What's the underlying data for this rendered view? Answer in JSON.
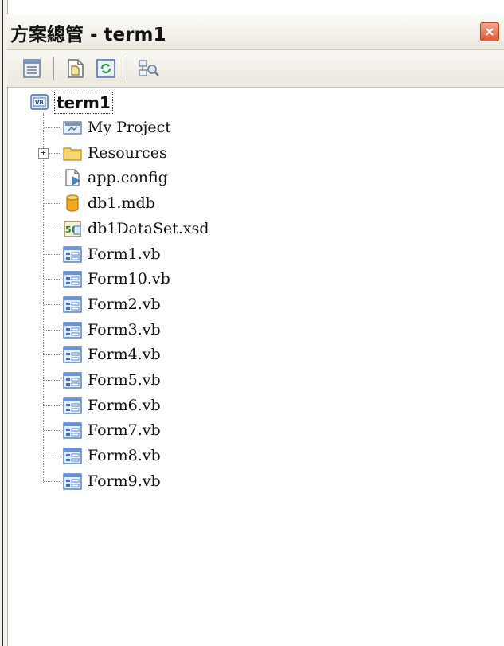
{
  "panel": {
    "title": "方案總管 - term1",
    "close_label": "×"
  },
  "toolbar": {
    "buttons": [
      {
        "name": "properties-icon"
      },
      {
        "name": "show-all-files-icon"
      },
      {
        "name": "refresh-icon"
      },
      {
        "name": "view-class-diagram-icon"
      }
    ]
  },
  "tree": {
    "root": {
      "label": "term1",
      "icon": "vb-project-icon"
    },
    "items": [
      {
        "label": "My Project",
        "icon": "my-project-icon",
        "expandable": false
      },
      {
        "label": "Resources",
        "icon": "folder-icon",
        "expandable": true
      },
      {
        "label": "app.config",
        "icon": "config-file-icon",
        "expandable": false
      },
      {
        "label": "db1.mdb",
        "icon": "database-icon",
        "expandable": false
      },
      {
        "label": "db1DataSet.xsd",
        "icon": "dataset-icon",
        "expandable": false
      },
      {
        "label": "Form1.vb",
        "icon": "form-icon",
        "expandable": false
      },
      {
        "label": "Form10.vb",
        "icon": "form-icon",
        "expandable": false
      },
      {
        "label": "Form2.vb",
        "icon": "form-icon",
        "expandable": false
      },
      {
        "label": "Form3.vb",
        "icon": "form-icon",
        "expandable": false
      },
      {
        "label": "Form4.vb",
        "icon": "form-icon",
        "expandable": false
      },
      {
        "label": "Form5.vb",
        "icon": "form-icon",
        "expandable": false
      },
      {
        "label": "Form6.vb",
        "icon": "form-icon",
        "expandable": false
      },
      {
        "label": "Form7.vb",
        "icon": "form-icon",
        "expandable": false
      },
      {
        "label": "Form8.vb",
        "icon": "form-icon",
        "expandable": false
      },
      {
        "label": "Form9.vb",
        "icon": "form-icon",
        "expandable": false
      }
    ]
  },
  "colors": {
    "close_button": "#e05a3a",
    "form_icon": "#3f6fc8",
    "folder": "#f0c040",
    "database": "#f0a820"
  }
}
